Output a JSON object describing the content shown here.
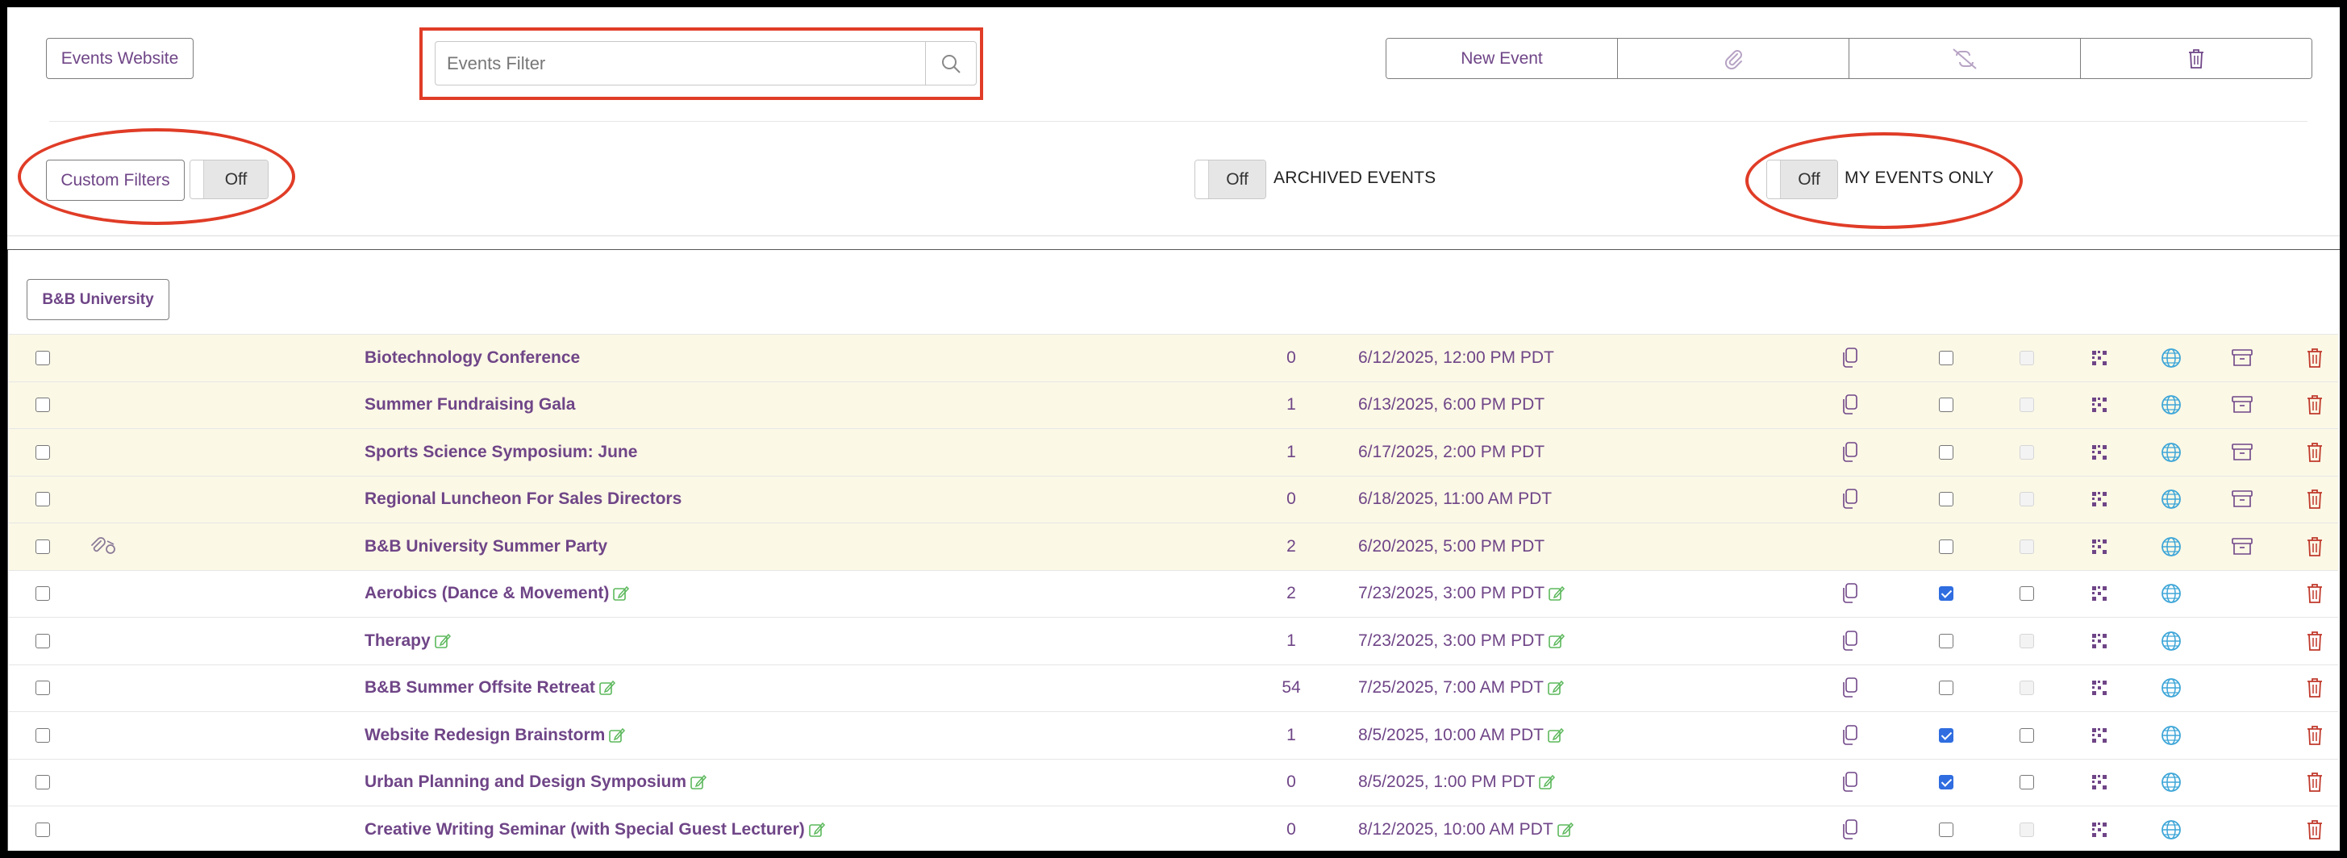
{
  "toolbar": {
    "events_website": "Events Website",
    "search_placeholder": "Events Filter",
    "new_event": "New Event"
  },
  "filters": {
    "custom_filters": "Custom Filters",
    "custom_filters_state": "Off",
    "archived_state": "Off",
    "archived_label": "ARCHIVED EVENTS",
    "my_events_state": "Off",
    "my_events_label": "MY EVENTS ONLY"
  },
  "group": {
    "name": "B&B University"
  },
  "colors": {
    "accent": "#6f4587",
    "annotation": "#e03c27",
    "archived_row_bg": "#fbf8e6",
    "edit_icon": "#5cb85c",
    "delete_icon": "#c0392b",
    "globe_icon": "#3ea6d8",
    "checkbox_checked": "#2f6de0"
  },
  "events": [
    {
      "name": "Biotechnology Conference",
      "count": "0",
      "date": "6/12/2025, 12:00 PM PDT",
      "archived": true,
      "edit": false,
      "clip": false,
      "copy": true,
      "check1": false,
      "check2": null
    },
    {
      "name": "Summer Fundraising Gala",
      "count": "1",
      "date": "6/13/2025, 6:00 PM PDT",
      "archived": true,
      "edit": false,
      "clip": false,
      "copy": true,
      "check1": false,
      "check2": null
    },
    {
      "name": "Sports Science Symposium: June",
      "count": "1",
      "date": "6/17/2025, 2:00 PM PDT",
      "archived": true,
      "edit": false,
      "clip": false,
      "copy": true,
      "check1": false,
      "check2": null
    },
    {
      "name": "Regional Luncheon For Sales Directors",
      "count": "0",
      "date": "6/18/2025, 11:00 AM PDT",
      "archived": true,
      "edit": false,
      "clip": false,
      "copy": true,
      "check1": false,
      "check2": null
    },
    {
      "name": "B&B University Summer Party",
      "count": "2",
      "date": "6/20/2025, 5:00 PM PDT",
      "archived": true,
      "edit": false,
      "clip": true,
      "copy": false,
      "check1": false,
      "check2": null
    },
    {
      "name": "Aerobics (Dance & Movement)",
      "count": "2",
      "date": "7/23/2025, 3:00 PM PDT",
      "archived": false,
      "edit": true,
      "clip": false,
      "copy": true,
      "check1": true,
      "check2": false
    },
    {
      "name": "Therapy",
      "count": "1",
      "date": "7/23/2025, 3:00 PM PDT",
      "archived": false,
      "edit": true,
      "clip": false,
      "copy": true,
      "check1": false,
      "check2": null
    },
    {
      "name": "B&B Summer Offsite Retreat",
      "count": "54",
      "date": "7/25/2025, 7:00 AM PDT",
      "archived": false,
      "edit": true,
      "clip": false,
      "copy": true,
      "check1": false,
      "check2": null
    },
    {
      "name": "Website Redesign Brainstorm",
      "count": "1",
      "date": "8/5/2025, 10:00 AM PDT",
      "archived": false,
      "edit": true,
      "clip": false,
      "copy": true,
      "check1": true,
      "check2": false
    },
    {
      "name": "Urban Planning and Design Symposium",
      "count": "0",
      "date": "8/5/2025, 1:00 PM PDT",
      "archived": false,
      "edit": true,
      "clip": false,
      "copy": true,
      "check1": true,
      "check2": false
    },
    {
      "name": "Creative Writing Seminar (with Special Guest Lecturer)",
      "count": "0",
      "date": "8/12/2025, 10:00 AM PDT",
      "archived": false,
      "edit": true,
      "clip": false,
      "copy": true,
      "check1": false,
      "check2": null
    }
  ]
}
